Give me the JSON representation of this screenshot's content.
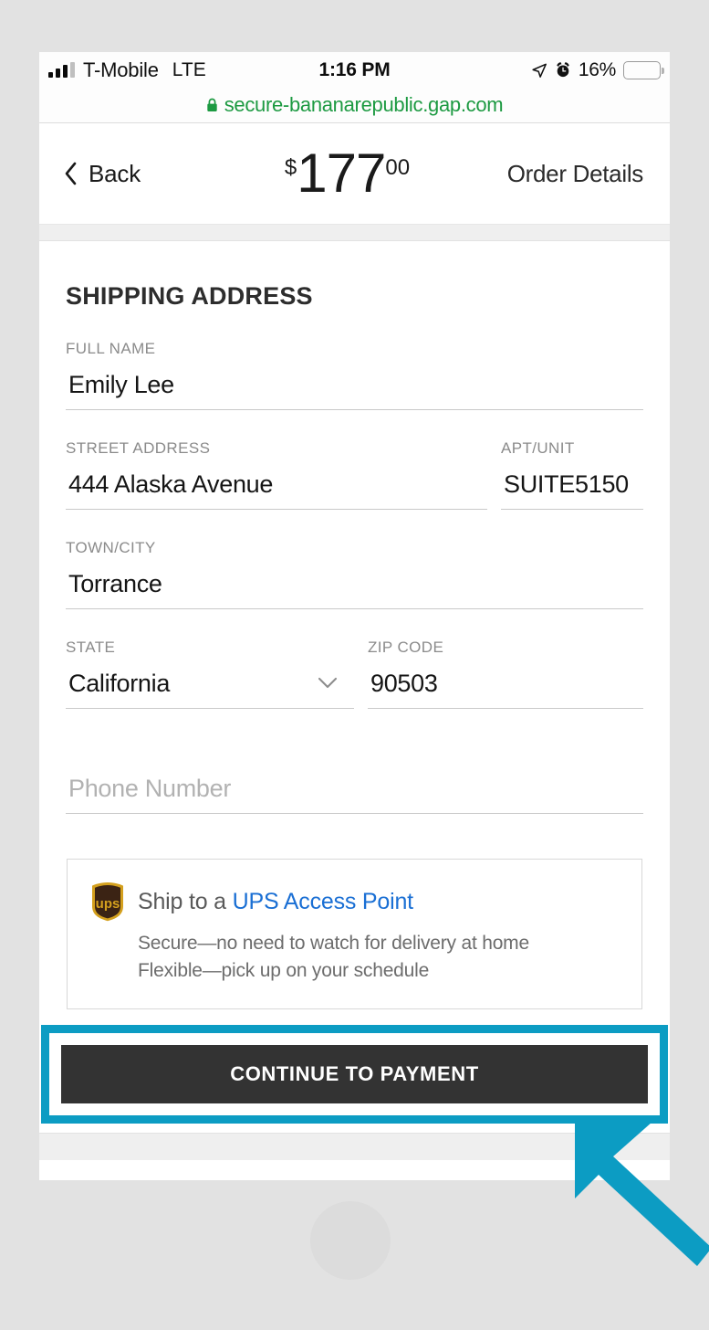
{
  "statusbar": {
    "carrier": "T-Mobile",
    "network": "LTE",
    "time": "1:16 PM",
    "battery_percent": "16%",
    "battery_level": 16,
    "icons": [
      "signal-bars-icon",
      "location-arrow-icon",
      "alarm-clock-icon",
      "battery-icon"
    ],
    "battery_color": "#f6c32b"
  },
  "browser": {
    "url": "secure-bananarepublic.gap.com",
    "secure_icon": "lock-icon",
    "url_color": "#1d9a42"
  },
  "order_header": {
    "back_label": "Back",
    "back_icon": "chevron-left-icon",
    "currency_symbol": "$",
    "amount": "177",
    "cents": "00",
    "order_details_label": "Order Details"
  },
  "shipping": {
    "section_title": "SHIPPING ADDRESS",
    "fields": [
      {
        "label": "FULL NAME",
        "value": "Emily Lee",
        "placeholder": "",
        "type": "text"
      },
      {
        "label": "STREET ADDRESS",
        "value": "444 Alaska Avenue",
        "placeholder": "",
        "type": "text"
      },
      {
        "label": "APT/UNIT",
        "value": "SUITE5150",
        "placeholder": "",
        "type": "text"
      },
      {
        "label": "TOWN/CITY",
        "value": "Torrance",
        "placeholder": "",
        "type": "text"
      },
      {
        "label": "STATE",
        "value": "California",
        "placeholder": "",
        "type": "select"
      },
      {
        "label": "ZIP CODE",
        "value": "90503",
        "placeholder": "",
        "type": "text"
      },
      {
        "label": "",
        "value": "",
        "placeholder": "Phone Number",
        "type": "tel"
      }
    ],
    "state_dropdown_icon": "chevron-down-icon"
  },
  "ups_promo": {
    "logo_icon": "ups-shield-icon",
    "title_prefix": "Ship to a ",
    "title_link": "UPS Access Point",
    "benefit_1": "Secure—no need to watch for delivery at home",
    "benefit_2": "Flexible—pick up on your schedule",
    "link_color": "#1a6fd4"
  },
  "cta": {
    "label": "CONTINUE TO PAYMENT",
    "background": "#333333",
    "highlight_color": "#0c9cc3"
  },
  "annotation": {
    "arrow_icon": "pointer-arrow-icon",
    "arrow_color": "#0c9cc3"
  }
}
